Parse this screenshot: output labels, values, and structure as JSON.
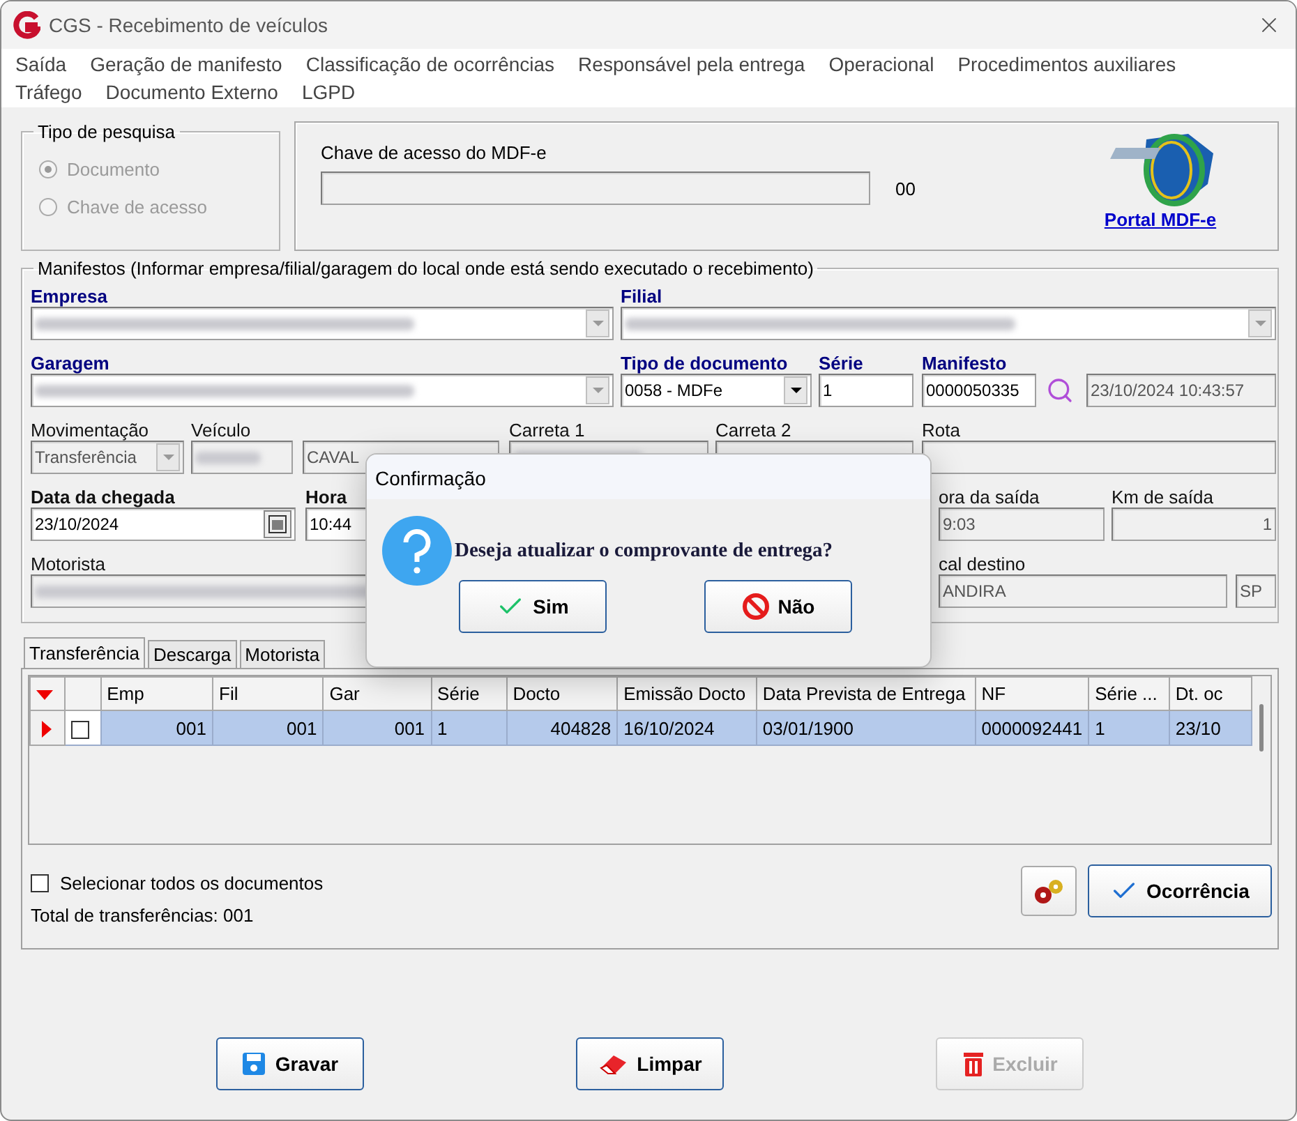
{
  "window": {
    "title": "CGS - Recebimento de veículos"
  },
  "menu": [
    "Saída",
    "Geração de manifesto",
    "Classificação de ocorrências",
    "Responsável pela entrega",
    "Operacional",
    "Procedimentos auxiliares",
    "Tráfego",
    "Documento Externo",
    "LGPD"
  ],
  "search_type": {
    "title": "Tipo de pesquisa",
    "options": [
      {
        "label": "Documento",
        "selected": true,
        "disabled": true
      },
      {
        "label": "Chave de acesso",
        "selected": false,
        "disabled": true
      }
    ]
  },
  "mdfe": {
    "label": "Chave de acesso do MDF-e",
    "counter": "00",
    "link": "Portal MDF-e"
  },
  "manifests": {
    "title": "Manifestos (Informar empresa/filial/garagem do local onde está sendo executado o recebimento)",
    "lines": [
      {
        "fields": [
          {
            "kind": "combo",
            "label": "Empresa",
            "required": true,
            "bold": true,
            "disabled": false,
            "redacted": true
          },
          {
            "kind": "combo",
            "label": "Filial",
            "required": true,
            "bold": true,
            "disabled": false,
            "redacted": true
          }
        ]
      },
      {
        "fields": [
          {
            "kind": "combo",
            "label": "Garagem",
            "required": true,
            "bold": true,
            "disabled": false,
            "redacted": true
          },
          {
            "kind": "dropdown",
            "label": "Tipo de documento",
            "required": true,
            "bold": true,
            "value": "0058 - MDFe",
            "disabled": false
          },
          {
            "kind": "text",
            "label": "Série",
            "required": true,
            "bold": true,
            "value": "1",
            "disabled": false
          },
          {
            "kind": "text",
            "label": "Manifesto",
            "required": true,
            "bold": true,
            "value": "0000050335",
            "disabled": false
          },
          {
            "kind": "search"
          },
          {
            "kind": "text",
            "value": "23/10/2024 10:43:57",
            "disabled": true
          }
        ]
      },
      {
        "fields": [
          {
            "kind": "combo",
            "label": "Movimentação",
            "required": false,
            "bold": false,
            "value": "Transferência",
            "disabled": true
          },
          {
            "kind": "text",
            "label": "Veículo",
            "required": false,
            "bold": false,
            "disabled": true,
            "redacted": true
          },
          {
            "kind": "text",
            "value": "CAVAL",
            "disabled": true
          },
          {
            "kind": "text",
            "label": "Carreta 1",
            "required": false,
            "bold": false,
            "disabled": true,
            "redacted": true
          },
          {
            "kind": "text",
            "label": "Carreta 2",
            "required": false,
            "bold": false,
            "disabled": true
          },
          {
            "kind": "text",
            "label": "Rota",
            "required": false,
            "bold": false,
            "disabled": true
          }
        ]
      },
      {
        "fields": [
          {
            "kind": "date",
            "label": "Data da chegada",
            "required": false,
            "bold": true,
            "value": "23/10/2024",
            "disabled": false
          },
          {
            "kind": "text",
            "label": "Hora",
            "required": false,
            "bold": true,
            "value": "10:44",
            "disabled": false
          },
          {
            "kind": "text",
            "label": "ora da saída",
            "required": false,
            "bold": false,
            "value": "9:03",
            "disabled": true
          },
          {
            "kind": "text",
            "label": "Km de saída",
            "required": false,
            "bold": false,
            "value": "1",
            "disabled": true
          }
        ]
      },
      {
        "fields": [
          {
            "kind": "text",
            "label": "Motorista",
            "required": false,
            "bold": false,
            "disabled": true,
            "redacted": true
          },
          {
            "kind": "text",
            "label": "cal destino",
            "required": false,
            "bold": false,
            "value": "ANDIRA",
            "disabled": true
          },
          {
            "kind": "text",
            "value": "SP",
            "disabled": true
          }
        ]
      }
    ]
  },
  "tabs": [
    {
      "label": "Transferência",
      "selected": true
    },
    {
      "label": "Descarga",
      "selected": false
    },
    {
      "label": "Motorista",
      "selected": false
    }
  ],
  "table": {
    "columns": [
      "",
      "",
      "Emp",
      "Fil",
      "Gar",
      "Série",
      "Docto",
      "Emissão Docto",
      "Data Prevista de Entrega",
      "NF",
      "Série ...",
      "Dt. oc"
    ],
    "rows": [
      {
        "selected": true,
        "checked": false,
        "cells": [
          "",
          "",
          "001",
          "001",
          "001",
          "1",
          "404828",
          "16/10/2024",
          "03/01/1900",
          "0000092441",
          "1",
          "23/10"
        ]
      }
    ]
  },
  "select_all": {
    "label": "Selecionar todos os documentos",
    "checked": false
  },
  "total": "Total de transferências: 001",
  "occurrence_button": "Ocorrência",
  "buttons": [
    {
      "kind": "save",
      "label": "Gravar",
      "disabled": false
    },
    {
      "kind": "clear",
      "label": "Limpar",
      "disabled": false
    },
    {
      "kind": "delete",
      "label": "Excluir",
      "disabled": true
    }
  ],
  "dialog": {
    "title": "Confirmação",
    "message": "Deseja atualizar o comprovante de entrega?",
    "buttons": [
      {
        "kind": "yes",
        "label": "Sim"
      },
      {
        "kind": "no",
        "label": "Não"
      }
    ]
  }
}
